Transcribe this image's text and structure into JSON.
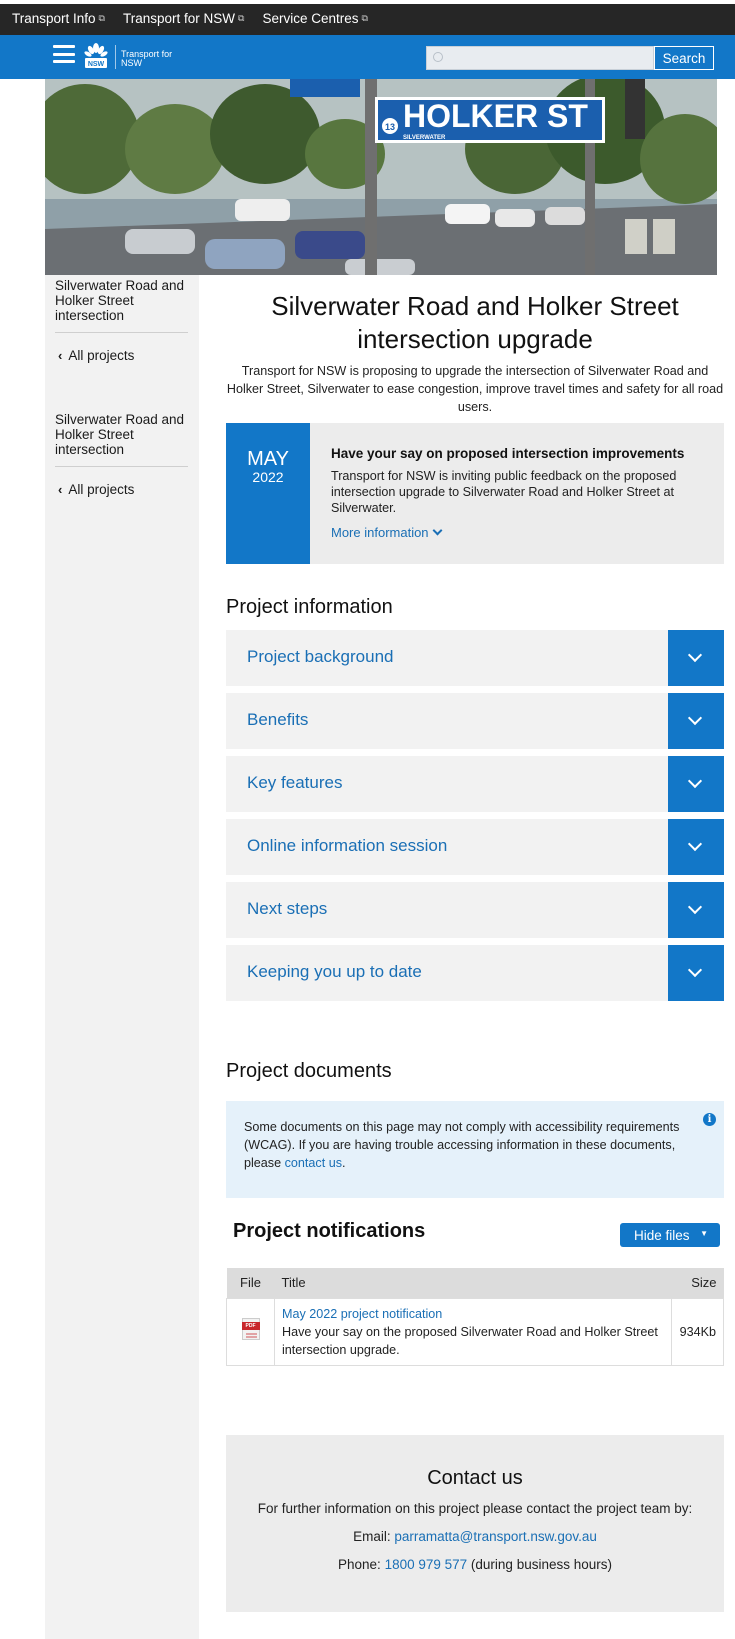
{
  "topbar": {
    "links": [
      "Transport Info",
      "Transport for NSW",
      "Service Centres"
    ]
  },
  "header": {
    "logo_text": "Transport for NSW",
    "logo_badge": "NSW",
    "search_placeholder": "",
    "search_button": "Search"
  },
  "hero": {
    "sign_text": "HOLKER ST",
    "sign_sub": "SILVERWATER",
    "sign_number": "13"
  },
  "sidebar": {
    "title_1": "Silverwater Road and Holker Street intersection",
    "link_1": "All projects",
    "title_2": "Silverwater Road and Holker Street intersection",
    "link_2": "All projects"
  },
  "main": {
    "title": "Silverwater Road and Holker Street intersection upgrade",
    "intro": "Transport for NSW is proposing to upgrade the intersection of Silverwater Road and Holker Street, Silverwater to ease congestion, improve travel times and safety for all road users."
  },
  "callout": {
    "month": "MAY",
    "year": "2022",
    "heading": "Have your say on proposed intersection improvements",
    "text": "Transport for NSW is inviting public feedback on the proposed intersection upgrade to Silverwater Road and Holker Street at Silverwater.",
    "more": "More information"
  },
  "project_info": {
    "heading": "Project information",
    "items": [
      "Project background",
      "Benefits",
      "Key features",
      "Online information session",
      "Next steps",
      "Keeping you up to date"
    ]
  },
  "project_documents": {
    "heading": "Project documents",
    "notice_before": "Some documents on this page may not comply with accessibility requirements (WCAG). If you are having trouble accessing information in these documents, please ",
    "notice_link": "contact us",
    "notice_after": "."
  },
  "notifications": {
    "heading": "Project notifications",
    "toggle": "Hide files",
    "columns": {
      "file": "File",
      "title": "Title",
      "size": "Size"
    },
    "rows": [
      {
        "link": "May 2022 project notification",
        "desc": "Have your say on the proposed Silverwater Road and Holker Street intersection upgrade.",
        "size": "934Kb",
        "icon": "pdf-icon"
      }
    ]
  },
  "contact": {
    "title": "Contact us",
    "intro": "For further information on this project please contact the project team by:",
    "email_label": "Email:",
    "email": "parramatta@transport.nsw.gov.au",
    "phone_label": "Phone:",
    "phone": "1800 979 577",
    "phone_note": "(during business hours)"
  },
  "colors": {
    "brand_blue": "#1277c8",
    "link_blue": "#1a6fb5",
    "topbar": "#262626",
    "panel_grey": "#f2f2f2",
    "notice_blue": "#e5f1fa"
  }
}
